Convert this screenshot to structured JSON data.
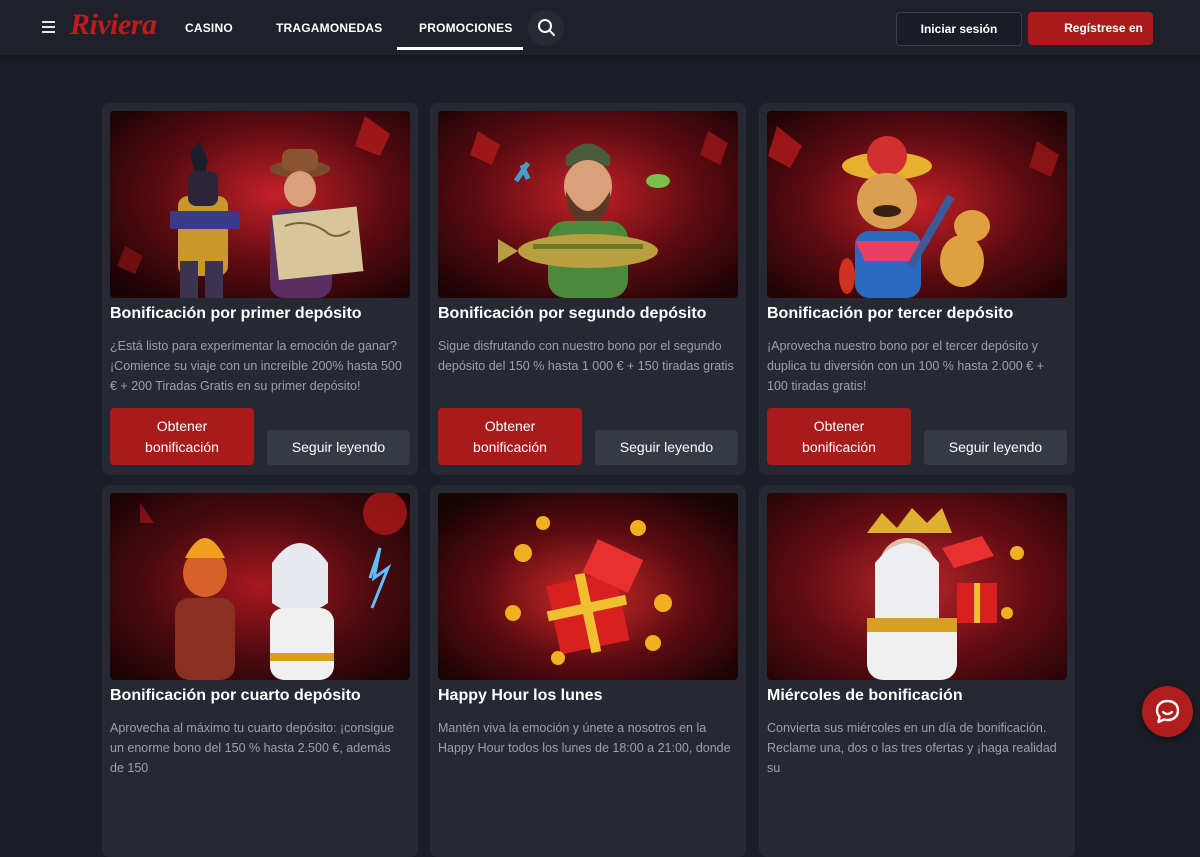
{
  "brand": {
    "logo": "Riviera"
  },
  "nav": {
    "casino": "CASINO",
    "slots": "TRAGAMONEDAS",
    "promos": "PROMOCIONES"
  },
  "auth": {
    "login": "Iniciar sesión",
    "register": "Regístrese en"
  },
  "buttons": {
    "get_bonus": "Obtener bonificación",
    "read_more": "Seguir leyendo"
  },
  "cards": [
    {
      "title": "Bonificación por primer depósito",
      "desc": "¿Está listo para experimentar la emoción de ganar? ¡Comience su viaje con un increíble 200% hasta 500 € + 200 Tiradas Gratis en su primer depósito!",
      "image": "anubis-and-explorer-illustration"
    },
    {
      "title": "Bonificación por segundo depósito",
      "desc": "Sigue disfrutando con nuestro bono por el segundo depósito del 150 % hasta 1 000 € + 150 tiradas gratis",
      "image": "fisherman-with-fish-illustration"
    },
    {
      "title": "Bonificación por tercer depósito",
      "desc": "¡Aprovecha nuestro bono por el tercer depósito y duplica tu diversión con un 100 % hasta 2.000 € + 100 tiradas gratis!",
      "image": "mariachi-dog-illustration"
    },
    {
      "title": "Bonificación por cuarto depósito",
      "desc": "Aprovecha al máximo tu cuarto depósito: ¡consigue un enorme bono del 150 % hasta 2.500 €, además de 150",
      "image": "fire-warrior-and-zeus-illustration"
    },
    {
      "title": "Happy Hour los lunes",
      "desc": "Mantén viva la emoción y únete a nosotros en la Happy Hour todos los lunes de 18:00 a 21:00, donde",
      "image": "gift-box-coins-illustration"
    },
    {
      "title": "Miércoles de bonificación",
      "desc": "Convierta sus miércoles en un día de bonificación. Reclame una, dos o las tres ofertas y ¡haga realidad su",
      "image": "zeus-with-gift-illustration"
    }
  ],
  "colors": {
    "accent": "#a91b1b",
    "background": "#1b1e26",
    "card": "#262932"
  },
  "icons": [
    "menu-icon",
    "search-icon",
    "chat-icon"
  ]
}
